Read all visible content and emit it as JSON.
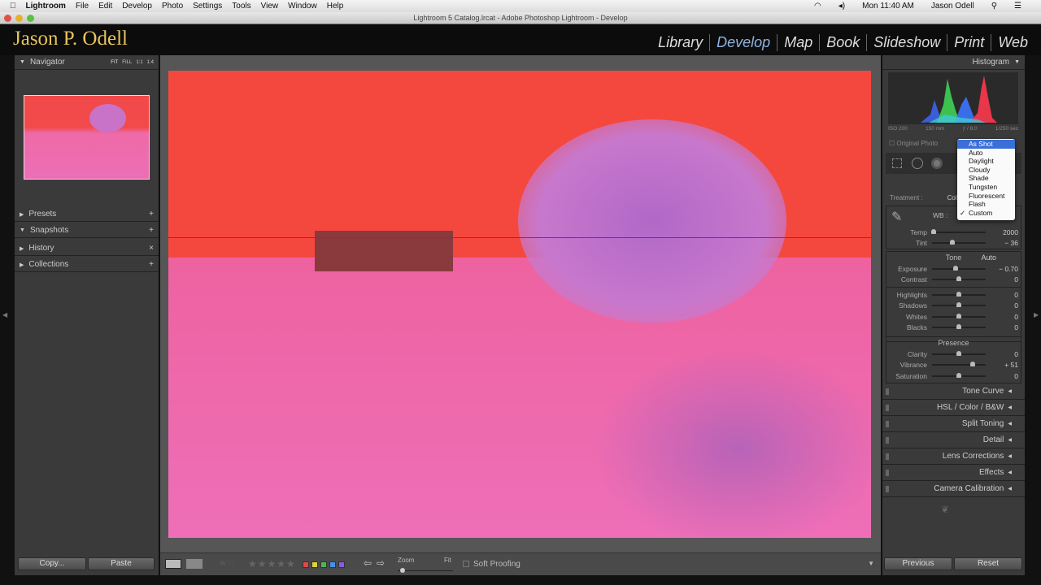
{
  "menubar": {
    "apple": "",
    "app": "Lightroom",
    "items": [
      "File",
      "Edit",
      "Develop",
      "Photo",
      "Settings",
      "Tools",
      "View",
      "Window",
      "Help"
    ],
    "clock": "Mon 11:40 AM",
    "user": "Jason Odell"
  },
  "window": {
    "title": "Lightroom 5 Catalog.lrcat - Adobe Photoshop Lightroom - Develop"
  },
  "identity_plate": "Jason P. Odell",
  "modules": [
    "Library",
    "Develop",
    "Map",
    "Book",
    "Slideshow",
    "Print",
    "Web"
  ],
  "active_module": "Develop",
  "left": {
    "navigator": "Navigator",
    "zoom_opts": [
      "FIT",
      "FILL",
      "1:1",
      "1:4"
    ],
    "panels": [
      {
        "label": "Presets",
        "icon": "+"
      },
      {
        "label": "Snapshots",
        "icon": "+"
      },
      {
        "label": "History",
        "icon": "×"
      },
      {
        "label": "Collections",
        "icon": "+"
      }
    ],
    "copy": "Copy...",
    "paste": "Paste"
  },
  "right": {
    "histogram": "Histogram",
    "iso": "ISO 200",
    "focal": "150 mm",
    "aperture": "ƒ / 8.0",
    "shutter": "1/250 sec",
    "original_photo": "Original Photo",
    "treatment_label": "Treatment :",
    "treatment_value": "Color",
    "wb_label": "WB :",
    "wb_menu": {
      "options": [
        "As Shot",
        "Auto",
        "Daylight",
        "Cloudy",
        "Shade",
        "Tungsten",
        "Fluorescent",
        "Flash",
        "Custom"
      ],
      "highlighted": "As Shot",
      "checked": "Custom"
    },
    "wb_sliders": [
      {
        "label": "Temp",
        "value": "2000",
        "pos": 0.03
      },
      {
        "label": "Tint",
        "value": "− 36",
        "pos": 0.38
      }
    ],
    "tone": "Tone",
    "auto": "Auto",
    "tone_sliders": [
      {
        "label": "Exposure",
        "value": "− 0.70",
        "pos": 0.44
      },
      {
        "label": "Contrast",
        "value": "0",
        "pos": 0.5
      }
    ],
    "tone_sliders2": [
      {
        "label": "Highlights",
        "value": "0",
        "pos": 0.5
      },
      {
        "label": "Shadows",
        "value": "0",
        "pos": 0.5
      },
      {
        "label": "Whites",
        "value": "0",
        "pos": 0.5
      },
      {
        "label": "Blacks",
        "value": "0",
        "pos": 0.5
      }
    ],
    "presence": "Presence",
    "presence_sliders": [
      {
        "label": "Clarity",
        "value": "0",
        "pos": 0.5
      },
      {
        "label": "Vibrance",
        "value": "+ 51",
        "pos": 0.75
      },
      {
        "label": "Saturation",
        "value": "0",
        "pos": 0.5
      }
    ],
    "panels": [
      "Tone Curve",
      "HSL / Color / B&W",
      "Split Toning",
      "Detail",
      "Lens Corrections",
      "Effects",
      "Camera Calibration"
    ],
    "previous": "Previous",
    "reset": "Reset"
  },
  "toolbar": {
    "zoom": "Zoom",
    "fit": "Fit",
    "soft_proofing": "Soft Proofing",
    "zoom_level": 0.05,
    "colors": [
      "#e04848",
      "#d8d43a",
      "#4cb84c",
      "#4a8ee0",
      "#8a5ae0"
    ]
  }
}
